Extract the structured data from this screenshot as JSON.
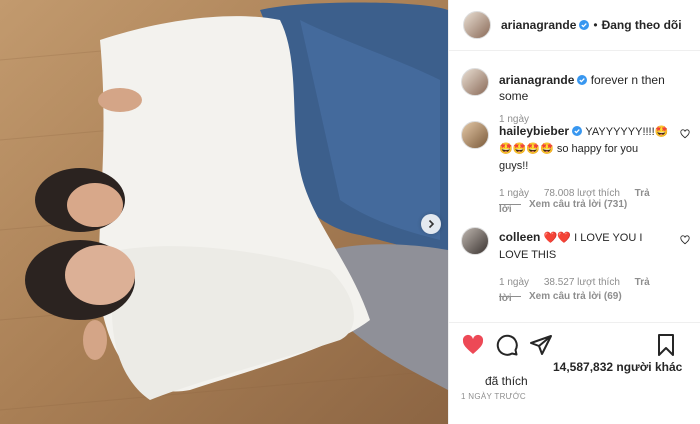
{
  "header": {
    "username": "arianagrande",
    "separator": "•",
    "follow_status": "Đang theo dõi"
  },
  "caption": {
    "username": "arianagrande",
    "text": "forever n then some",
    "time": "1 ngày"
  },
  "comments": [
    {
      "username": "haileybieber",
      "verified": true,
      "text": "YAYYYYYY!!!!🤩🤩🤩🤩🤩 so happy for you guys!!",
      "time": "1 ngày",
      "likes": "78.008 lượt thích",
      "reply": "Trả lời",
      "view_replies": "Xem câu trả lời (731)"
    },
    {
      "username": "colleen",
      "verified": false,
      "text": "❤️❤️ I LOVE YOU I LOVE THIS",
      "time": "1 ngày",
      "likes": "38.527 lượt thích",
      "reply": "Trả lời",
      "view_replies": "Xem câu trả lời (69)"
    }
  ],
  "likes_summary": {
    "count": "14,587,832 người khác",
    "liked_label": "đã thích"
  },
  "timestamp": "1 NGÀY TRƯỚC",
  "icons": [
    "next-arrow-icon",
    "verified-badge-icon",
    "heart-icon",
    "comment-icon",
    "share-icon",
    "bookmark-icon"
  ],
  "colors": {
    "verified": "#3897f0",
    "liked_heart": "#ed4956",
    "muted_text": "#8e8e8e"
  }
}
